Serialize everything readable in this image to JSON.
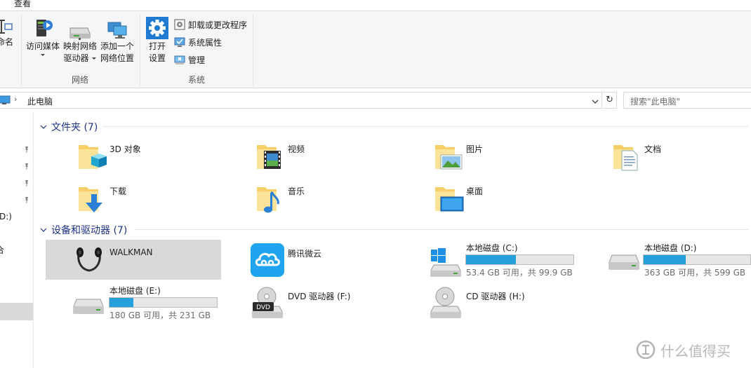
{
  "tabs": {
    "view": "查看"
  },
  "ribbon": {
    "rename_fragment": "命名",
    "access_media": "访问媒体",
    "map_drive_line1": "映射网络",
    "map_drive_line2": "驱动器",
    "add_location_line1": "添加一个",
    "add_location_line2": "网络位置",
    "group_network": "网络",
    "open_settings_line1": "打开",
    "open_settings_line2": "设置",
    "uninstall": "卸载或更改程序",
    "system_properties": "系统属性",
    "manage": "管理",
    "group_system": "系统"
  },
  "address": {
    "path": "此电脑",
    "search_placeholder": "搜索\"此电脑\""
  },
  "nav": {
    "drive_fragment": "D:)",
    "item_fragment": "合"
  },
  "folders_section": {
    "title": "文件夹 (7)",
    "items": [
      "3D 对象",
      "视频",
      "图片",
      "文档",
      "下载",
      "音乐",
      "桌面"
    ]
  },
  "devices_section": {
    "title": "设备和驱动器 (7)",
    "items": [
      {
        "name": "WALKMAN"
      },
      {
        "name": "腾讯微云"
      },
      {
        "name": "本地磁盘 (C:)",
        "free": "53.4 GB 可用，共 99.9 GB",
        "used_fraction": 0.465
      },
      {
        "name": "本地磁盘 (D:)",
        "free": "363 GB 可用，共 599 GB",
        "used_fraction": 0.394
      },
      {
        "name": "本地磁盘 (E:)",
        "free": "180 GB 可用，共 231 GB",
        "used_fraction": 0.221
      },
      {
        "name": "DVD 驱动器 (F:)",
        "icon_text": "DVD"
      },
      {
        "name": "CD 驱动器 (H:)"
      }
    ]
  },
  "watermark": {
    "text": "什么值得买"
  },
  "colors": {
    "accent": "#26a0da",
    "section_title": "#1e3287",
    "selection": "#d9d9d9"
  }
}
